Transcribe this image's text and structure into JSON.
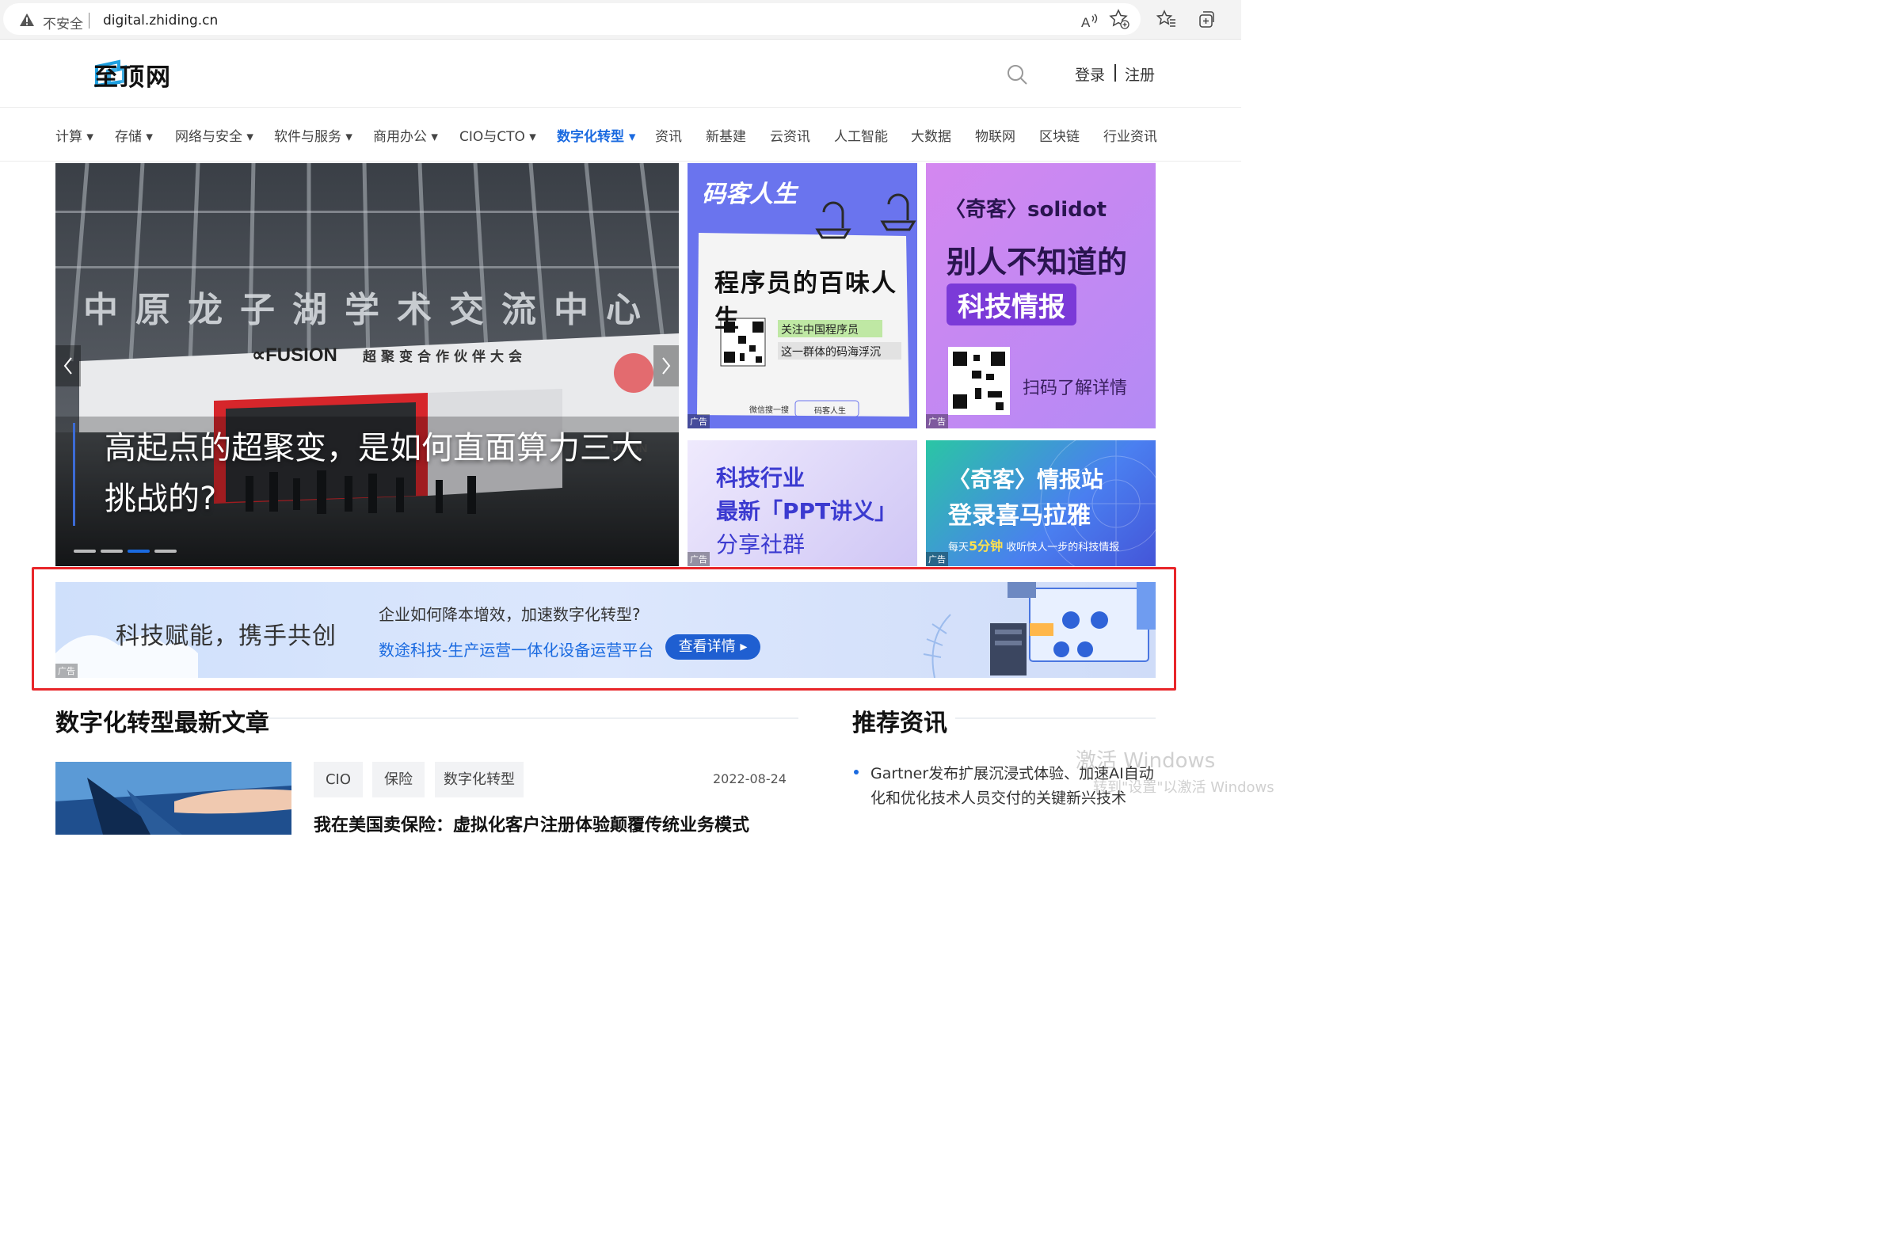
{
  "browser": {
    "security_label": "不安全",
    "url": "digital.zhiding.cn",
    "icons": [
      "read-aloud-icon",
      "add-favorite-icon",
      "favorites-icon",
      "collections-icon"
    ]
  },
  "header": {
    "logo_text": "至顶网",
    "login": "登录",
    "register": "注册"
  },
  "nav": {
    "items": [
      {
        "label": "计算",
        "dropdown": true
      },
      {
        "label": "存储",
        "dropdown": true
      },
      {
        "label": "网络与安全",
        "dropdown": true
      },
      {
        "label": "软件与服务",
        "dropdown": true
      },
      {
        "label": "商用办公",
        "dropdown": true
      },
      {
        "label": "CIO与CTO",
        "dropdown": true
      },
      {
        "label": "数字化转型",
        "dropdown": true,
        "active": true
      },
      {
        "label": "资讯",
        "dropdown": false
      },
      {
        "label": "新基建",
        "dropdown": false
      },
      {
        "label": "云资讯",
        "dropdown": false
      },
      {
        "label": "人工智能",
        "dropdown": false
      },
      {
        "label": "大数据",
        "dropdown": false
      },
      {
        "label": "物联网",
        "dropdown": false
      },
      {
        "label": "区块链",
        "dropdown": false
      },
      {
        "label": "行业资讯",
        "dropdown": false
      }
    ],
    "active_color": "#1a6ae0"
  },
  "carousel": {
    "title": "高起点的超聚变，是如何直面算力三大挑战的?",
    "building_sign": "中原龙子湖学术交流中心",
    "event_brand": "FUSION",
    "event_name": "超聚变合作伙伴大会",
    "slide_count": 4,
    "active_slide": 3
  },
  "ads": {
    "tile1": {
      "brand": "码客人生",
      "headline": "程序员的百味人生",
      "line1": "关注中国程序员",
      "line2": "这一群体的码海浮沉",
      "search_hint": "微信搜一搜",
      "search_term": "码客人生",
      "ad_label": "广告"
    },
    "tile2": {
      "brand_left": "〈奇客〉",
      "brand_right": "solidot",
      "line1": "别人不知道的",
      "line2": "科技情报",
      "cta": "扫码了解详情",
      "ad_label": "广告"
    },
    "tile3": {
      "line1": "科技行业",
      "line2": "最新「PPT讲义」",
      "line3": "分享社群",
      "ad_label": "广告"
    },
    "tile4": {
      "line1": "〈奇客〉情报站",
      "line2": "登录喜马拉雅",
      "line3_pre": "每天",
      "line3_hl": "5分钟",
      "line3_post": " 收听快人一步的科技情报",
      "ad_label": "广告"
    }
  },
  "banner": {
    "slogan": "科技赋能，携手共创",
    "question": "企业如何降本增效，加速数字化转型?",
    "link": "数途科技-生产运营一体化设备运营平台",
    "button": "查看详情",
    "ad_label": "广告"
  },
  "latest": {
    "title": "数字化转型最新文章",
    "tags": [
      "CIO",
      "保险",
      "数字化转型"
    ],
    "date": "2022-08-24",
    "article_title": "我在美国卖保险：虚拟化客户注册体验颠覆传统业务模式"
  },
  "recommended": {
    "title": "推荐资讯",
    "items": [
      "Gartner发布扩展沉浸式体验、加速AI自动化和优化技术人员交付的关键新兴技术"
    ]
  },
  "os_watermark": {
    "line1": "激活 Windows",
    "line2": "转到\"设置\"以激活 Windows"
  }
}
